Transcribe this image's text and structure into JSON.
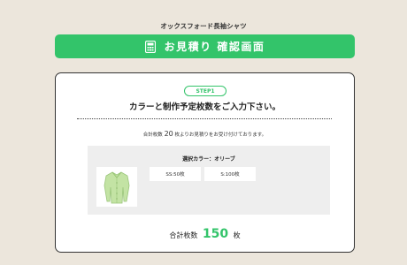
{
  "product": {
    "name": "オックスフォード長袖シャツ"
  },
  "banner": {
    "icon": "calculator-icon",
    "title": "お見積り 確認画面"
  },
  "step": {
    "badge": "STEP1",
    "heading": "カラーと制作予定枚数をご入力下さい。"
  },
  "note": {
    "prefix": "合計枚数",
    "count": "20",
    "suffix": "枚よりお見積りをお受け付けております。"
  },
  "selection": {
    "color_label": "選択カラー：オリーブ",
    "image": "shirt-icon",
    "sizes": [
      {
        "label": "SS:50枚"
      },
      {
        "label": "S:100枚"
      }
    ]
  },
  "total": {
    "prefix": "合計枚数",
    "value": "150",
    "suffix": "枚"
  },
  "colors": {
    "accent": "#33c46a",
    "background": "#ece6dc",
    "shirt": "#c3e3a4"
  }
}
